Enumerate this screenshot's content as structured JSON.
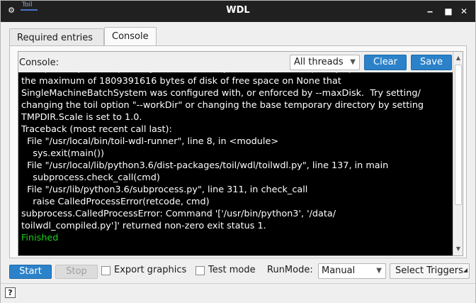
{
  "window": {
    "app_name": "Toil",
    "title": "WDL",
    "controls": {
      "minimize": "‒",
      "maximize": "■",
      "close": "✕"
    }
  },
  "tabs": [
    {
      "label": "Required entries",
      "active": false
    },
    {
      "label": "Console",
      "active": true
    }
  ],
  "console": {
    "label": "Console:",
    "thread_filter": "All threads",
    "clear_label": "Clear",
    "save_label": "Save",
    "lines": [
      "the maximum of 1809391616 bytes of disk of free space on None that",
      "SingleMachineBatchSystem was configured with, or enforced by --maxDisk.  Try setting/",
      "changing the toil option \"--workDir\" or changing the base temporary directory by setting",
      "TMPDIR.Scale is set to 1.0.",
      "Traceback (most recent call last):",
      "  File \"/usr/local/bin/toil-wdl-runner\", line 8, in <module>",
      "    sys.exit(main())",
      "  File \"/usr/local/lib/python3.6/dist-packages/toil/wdl/toilwdl.py\", line 137, in main",
      "    subprocess.check_call(cmd)",
      "  File \"/usr/lib/python3.6/subprocess.py\", line 311, in check_call",
      "    raise CalledProcessError(retcode, cmd)",
      "subprocess.CalledProcessError: Command '['/usr/bin/python3', '/data/",
      "toilwdl_compiled.py']' returned non-zero exit status 1."
    ],
    "status_line": "Finished"
  },
  "bottom": {
    "start_label": "Start",
    "stop_label": "Stop",
    "export_graphics_label": "Export graphics",
    "test_mode_label": "Test mode",
    "runmode_label": "RunMode:",
    "runmode_value": "Manual",
    "select_triggers_label": "Select Triggers"
  },
  "statusbar": {
    "help": "?"
  },
  "colors": {
    "accent": "#2b82c9",
    "terminal_bg": "#000000",
    "finished": "#19d219"
  }
}
